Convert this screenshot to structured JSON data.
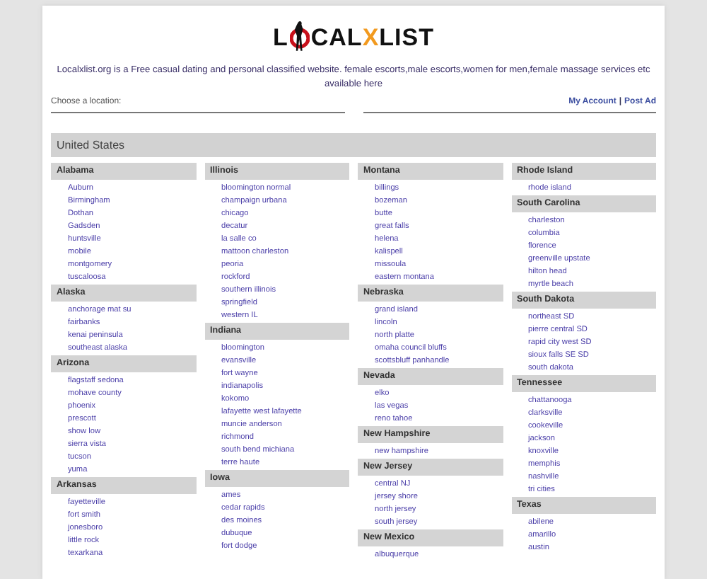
{
  "logo": {
    "lead": "L",
    "middle": "CAL",
    "accent": "X",
    "tail": "LIST"
  },
  "description": "Localxlist.org is a Free casual dating and personal classified website. female escorts,male escorts,women for men,female massage services etc available here",
  "location_label": "Choose a location:",
  "account_links": [
    "My Account",
    "Post Ad"
  ],
  "link_separator": "|",
  "country": "United States",
  "columns": [
    [
      {
        "state": "Alabama",
        "cities": [
          "Auburn",
          "Birmingham",
          "Dothan",
          "Gadsden",
          "huntsville",
          "mobile",
          "montgomery",
          "tuscaloosa"
        ]
      },
      {
        "state": "Alaska",
        "cities": [
          "anchorage mat su",
          "fairbanks",
          "kenai peninsula",
          "southeast alaska"
        ]
      },
      {
        "state": "Arizona",
        "cities": [
          "flagstaff sedona",
          "mohave county",
          "phoenix",
          "prescott",
          "show low",
          "sierra vista",
          "tucson",
          "yuma"
        ]
      },
      {
        "state": "Arkansas",
        "cities": [
          "fayetteville",
          "fort smith",
          "jonesboro",
          "little rock",
          "texarkana"
        ]
      }
    ],
    [
      {
        "state": "Illinois",
        "cities": [
          "bloomington normal",
          "champaign urbana",
          "chicago",
          "decatur",
          "la salle co",
          "mattoon charleston",
          "peoria",
          "rockford",
          "southern illinois",
          "springfield",
          "western IL"
        ]
      },
      {
        "state": "Indiana",
        "cities": [
          "bloomington",
          "evansville",
          "fort wayne",
          "indianapolis",
          "kokomo",
          "lafayette west lafayette",
          "muncie anderson",
          "richmond",
          "south bend michiana",
          "terre haute"
        ]
      },
      {
        "state": "Iowa",
        "cities": [
          "ames",
          "cedar rapids",
          "des moines",
          "dubuque",
          "fort dodge"
        ]
      }
    ],
    [
      {
        "state": "Montana",
        "cities": [
          "billings",
          "bozeman",
          "butte",
          "great falls",
          "helena",
          "kalispell",
          "missoula",
          "eastern montana"
        ]
      },
      {
        "state": "Nebraska",
        "cities": [
          "grand island",
          "lincoln",
          "north platte",
          "omaha council bluffs",
          "scottsbluff panhandle"
        ]
      },
      {
        "state": "Nevada",
        "cities": [
          "elko",
          "las vegas",
          "reno tahoe"
        ]
      },
      {
        "state": "New Hampshire",
        "cities": [
          "new hampshire"
        ]
      },
      {
        "state": "New Jersey",
        "cities": [
          "central NJ",
          "jersey shore",
          "north jersey",
          "south jersey"
        ]
      },
      {
        "state": "New Mexico",
        "cities": [
          "albuquerque"
        ]
      }
    ],
    [
      {
        "state": "Rhode Island",
        "cities": [
          "rhode island"
        ]
      },
      {
        "state": "South Carolina",
        "cities": [
          "charleston",
          "columbia",
          "florence",
          "greenville upstate",
          "hilton head",
          "myrtle beach"
        ]
      },
      {
        "state": "South Dakota",
        "cities": [
          "northeast SD",
          "pierre central SD",
          "rapid city west SD",
          "sioux falls SE SD",
          "south dakota"
        ]
      },
      {
        "state": "Tennessee",
        "cities": [
          "chattanooga",
          "clarksville",
          "cookeville",
          "jackson",
          "knoxville",
          "memphis",
          "nashville",
          "tri cities"
        ]
      },
      {
        "state": "Texas",
        "cities": [
          "abilene",
          "amarillo",
          "austin"
        ]
      }
    ]
  ]
}
